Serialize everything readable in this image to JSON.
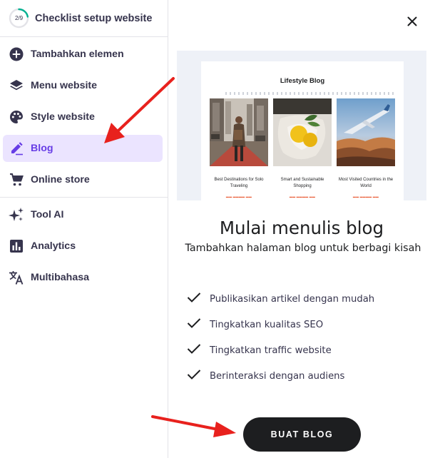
{
  "sidebar": {
    "checklist": {
      "progress_text": "2/9",
      "progress": 0.222,
      "title": "Checklist setup website"
    },
    "items": [
      {
        "label": "Tambahkan elemen",
        "icon": "add-circle-icon"
      },
      {
        "label": "Menu website",
        "icon": "layers-icon"
      },
      {
        "label": "Style website",
        "icon": "palette-icon"
      },
      {
        "label": "Blog",
        "icon": "pen-icon",
        "active": true
      },
      {
        "label": "Online store",
        "icon": "cart-icon"
      },
      {
        "label": "Tool AI",
        "icon": "sparkle-icon"
      },
      {
        "label": "Analytics",
        "icon": "bar-chart-icon"
      },
      {
        "label": "Multibahasa",
        "icon": "translate-icon"
      }
    ]
  },
  "panel": {
    "close_icon": "close-icon",
    "preview": {
      "title": "Lifestyle Blog",
      "posts": [
        {
          "title": "Best Destinations for Solo Traveling"
        },
        {
          "title": "Smart and Sustainable Shopping"
        },
        {
          "title": "Most Visited Countries in the World"
        }
      ]
    },
    "headline": "Mulai menulis blog",
    "subheadline": "Tambahkan halaman blog untuk berbagi kisah",
    "features": [
      "Publikasikan artikel dengan mudah",
      "Tingkatkan kualitas SEO",
      "Tingkatkan traffic website",
      "Berinteraksi dengan audiens"
    ],
    "cta_label": "BUAT BLOG"
  },
  "colors": {
    "accent": "#673de6",
    "active_bg": "#ebe4ff",
    "progress": "#00b090",
    "cta_bg": "#1d1e20",
    "annotation_arrow": "#e8211d"
  }
}
